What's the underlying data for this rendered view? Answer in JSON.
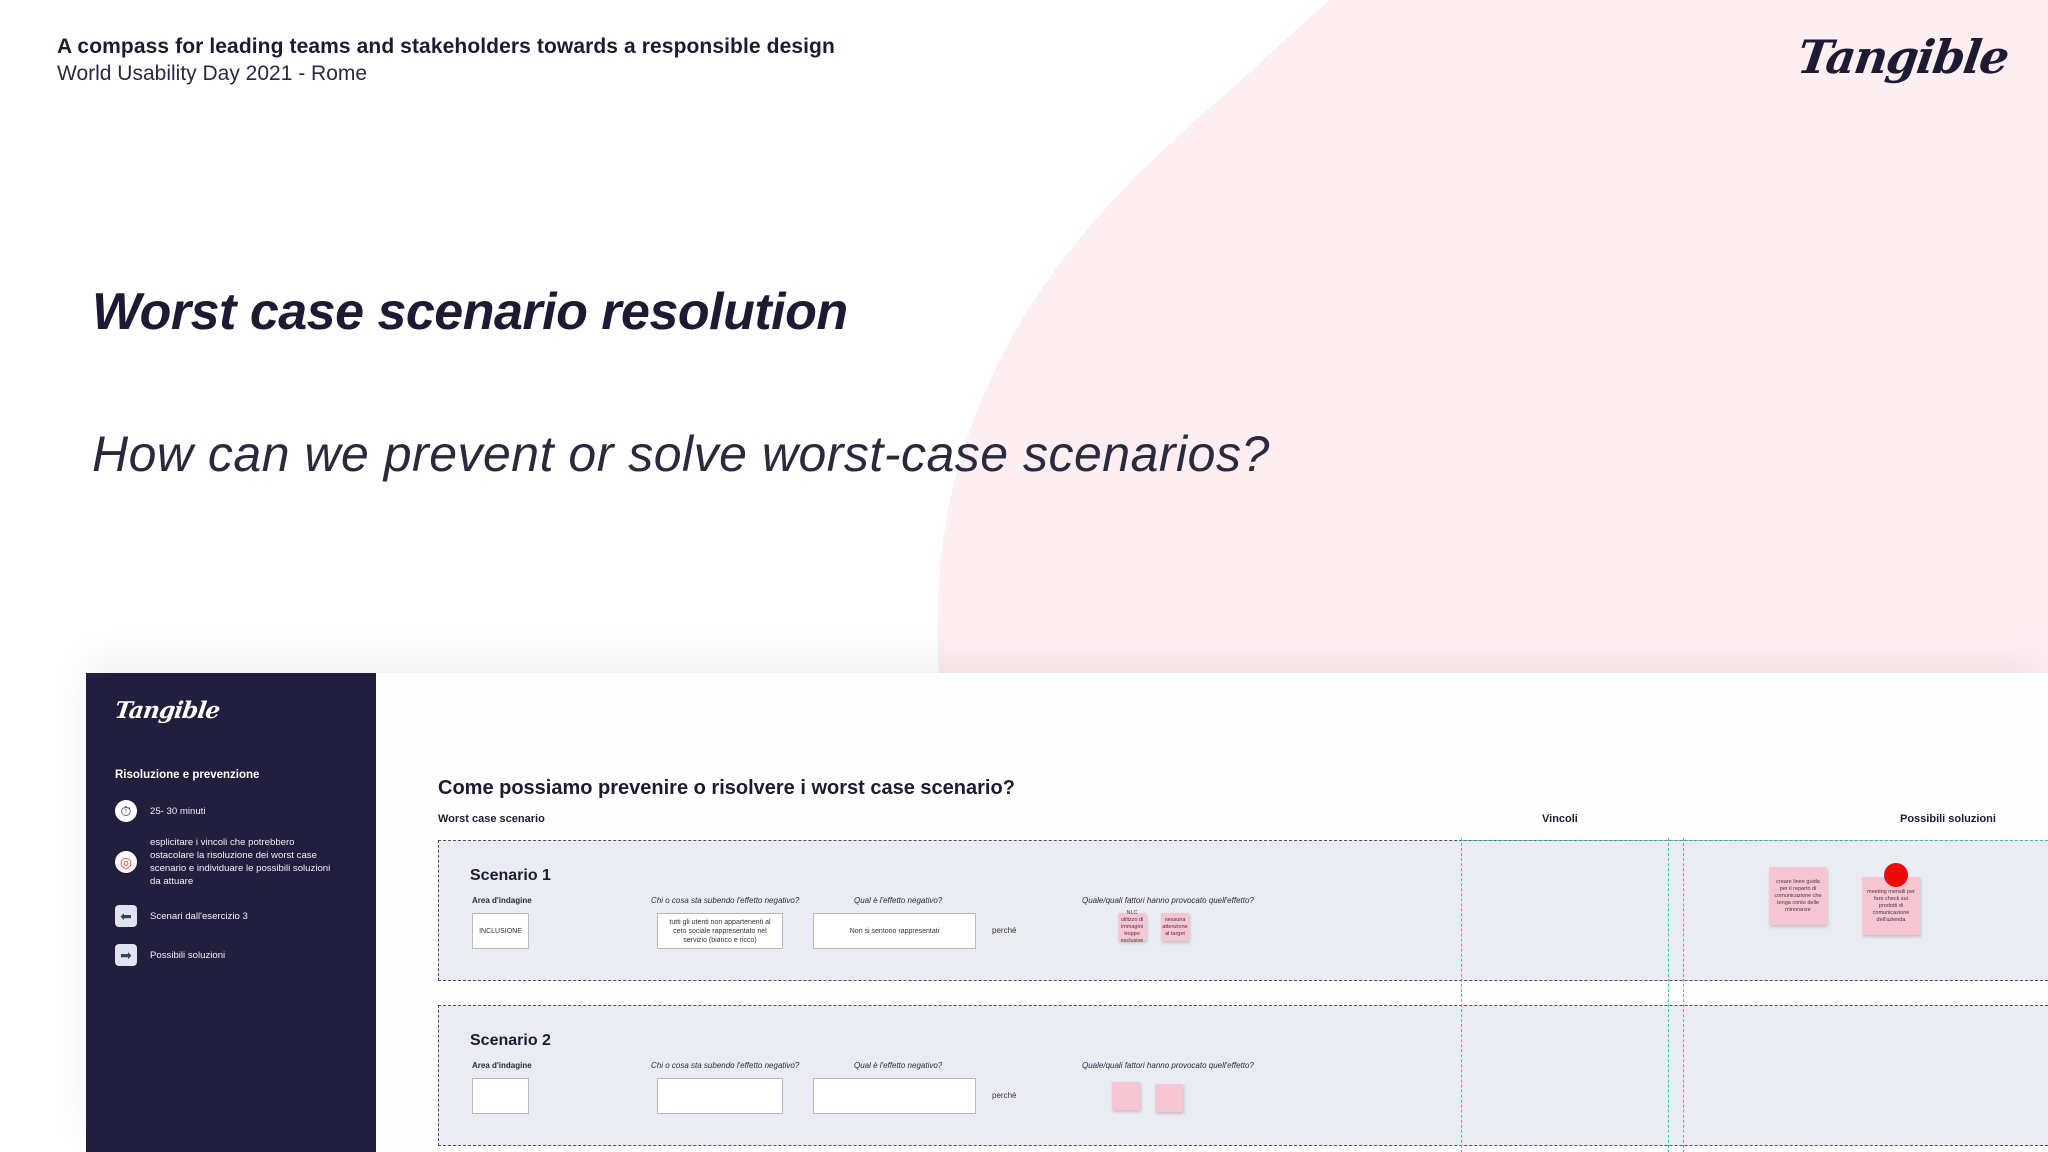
{
  "header": {
    "title": "A compass for leading teams and stakeholders towards a responsible design",
    "subtitle": "World Usability Day 2021 - Rome",
    "logo": "Tangible"
  },
  "slide": {
    "title": "Worst case scenario resolution",
    "question": "How can we prevent or solve worst-case scenarios?"
  },
  "board": {
    "sidebar": {
      "logo": "Tangible",
      "heading": "Risoluzione e prevenzione",
      "items": [
        {
          "icon": "stopwatch-icon",
          "text": "25- 30 minuti"
        },
        {
          "icon": "target-icon",
          "text": "esplicitare i vincoli che potrebbero ostacolare la risoluzione dei worst case scenario e individuare le possibili soluzioni da attuare"
        },
        {
          "icon": "left-arrow-icon",
          "text": "Scenari dall'esercizio 3"
        },
        {
          "icon": "right-arrow-icon",
          "text": "Possibili soluzioni"
        }
      ]
    },
    "canvas": {
      "title": "Come possiamo prevenire o risolvere i worst case scenario?",
      "columns": {
        "worst": "Worst case scenario",
        "vincoli": "Vincoli",
        "soluzioni": "Possibili soluzioni"
      },
      "field_labels": {
        "area": "Area d'indagine",
        "chi": "Chi o cosa sta subendo l'effetto negativo?",
        "quale": "Qual è l'effetto negativo?",
        "fattori": "Quale/quali fattori hanno provocato quell'effetto?",
        "perche": "perché"
      },
      "scenarios": [
        {
          "title": "Scenario 1",
          "area": "INCLUSIONE",
          "chi": "tutti gli utenti non appartenenti al ceto sociale rappresentato nel servizio (bianco e ricco)",
          "quale": "Non si sentono rappresentati",
          "factor_notes": [
            "NLC utilizzo di immagini troppo esclusive",
            "nessuna attenzione al target"
          ],
          "solution_notes": [
            "creare linee guida per il reparto di comunicazione che tenga conto delle minoranze",
            "meeting mensili per fare check sui prodotti di comunicazione dell'azienda"
          ]
        },
        {
          "title": "Scenario 2",
          "area": "",
          "chi": "",
          "quale": ""
        }
      ]
    }
  },
  "colors": {
    "navy": "#221e3d",
    "blob_pink": "#fdeef2",
    "sticky_pink": "#f6c6d3",
    "teal_guides": "#3fc2b4",
    "red_dot": "#ea0b0b"
  }
}
